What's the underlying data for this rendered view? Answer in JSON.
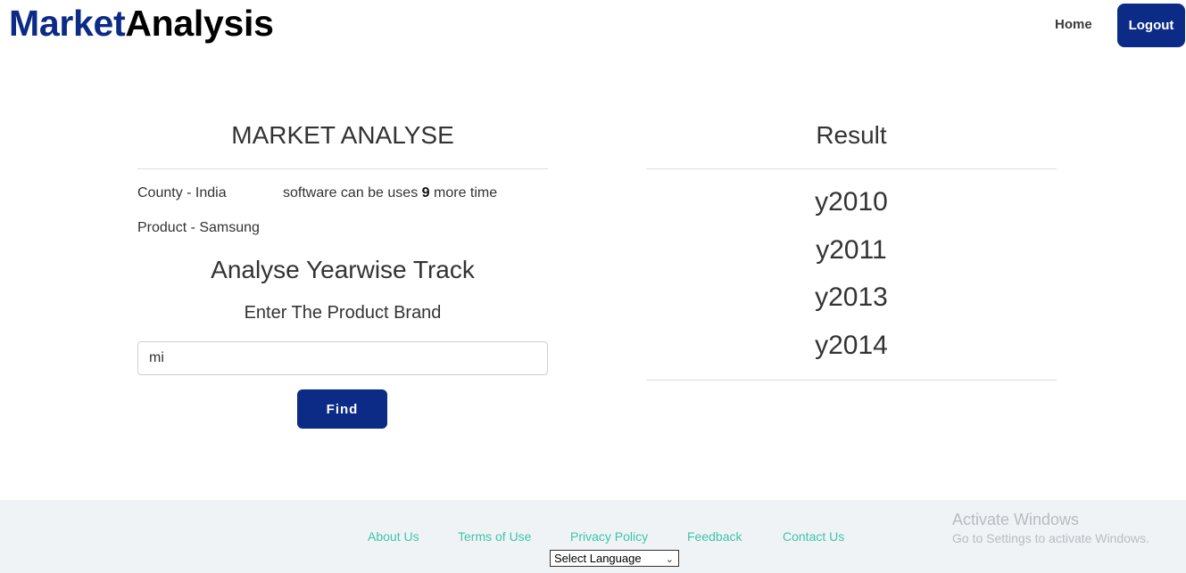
{
  "header": {
    "brand_part1": "Market",
    "brand_part2": "Analysis",
    "nav_home": "Home",
    "logout_label": "Logout"
  },
  "left_panel": {
    "title": "MARKET ANALYSE",
    "country_text": "County - India",
    "usage_prefix": "software can be uses",
    "usage_count": "9",
    "usage_suffix": "more time",
    "product_text": "Product - Samsung",
    "subtitle": "Analyse Yearwise Track",
    "prompt": "Enter The Product Brand",
    "input_value": "mi",
    "find_label": "Find"
  },
  "right_panel": {
    "title": "Result",
    "results": [
      "y2010",
      "y2011",
      "y2013",
      "y2014"
    ]
  },
  "footer": {
    "links": [
      "About Us",
      "Terms of Use",
      "Privacy Policy",
      "Feedback",
      "Contact Us"
    ],
    "language_select": "Select Language"
  },
  "watermark": {
    "line1": "Activate Windows",
    "line2": "Go to Settings to activate Windows."
  },
  "colors": {
    "brand_blue": "#0c2b86",
    "link_teal": "#3cc6a8",
    "footer_bg": "#f0f3f6"
  }
}
